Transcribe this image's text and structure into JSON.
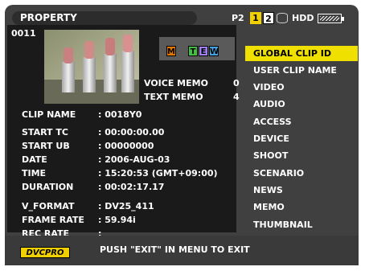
{
  "header": {
    "title": "PROPERTY",
    "media_label": "P2",
    "slot1": "1",
    "slot2": "2",
    "hdd_label": "HDD",
    "hdd_icon": "hdd-icon",
    "battery_icon": "battery-icon"
  },
  "clip": {
    "number": "0011",
    "indicators": [
      "M",
      "T",
      "E",
      "W"
    ],
    "voice_memo_label": "VOICE MEMO",
    "voice_memo_count": "0",
    "text_memo_label": "TEXT MEMO",
    "text_memo_count": "4"
  },
  "properties": [
    {
      "label": "CLIP NAME",
      "value": ": 0018Y0"
    },
    {
      "label": "START TC",
      "value": ": 00:00:00.00"
    },
    {
      "label": "START UB",
      "value": ": 00000000"
    },
    {
      "label": "DATE",
      "value": ": 2006-AUG-03"
    },
    {
      "label": "TIME",
      "value": ": 15:20:53 (GMT+09:00)"
    },
    {
      "label": "DURATION",
      "value": ": 00:02:17.17"
    },
    {
      "label": "V_FORMAT",
      "value": ": DV25_411"
    },
    {
      "label": "FRAME RATE",
      "value": ": 59.94i"
    },
    {
      "label": "REC RATE",
      "value": ":"
    }
  ],
  "menu": [
    "GLOBAL CLIP ID",
    "USER CLIP NAME",
    "VIDEO",
    "AUDIO",
    "ACCESS",
    "DEVICE",
    "SHOOT",
    "SCENARIO",
    "NEWS",
    "MEMO",
    "THUMBNAIL"
  ],
  "selected_menu": "GLOBAL CLIP ID",
  "footer": {
    "logo": "DVCPRO",
    "message": "PUSH \"EXIT\" IN MENU TO EXIT"
  },
  "colors": {
    "highlight": "#f0e000",
    "background": "#404040"
  }
}
